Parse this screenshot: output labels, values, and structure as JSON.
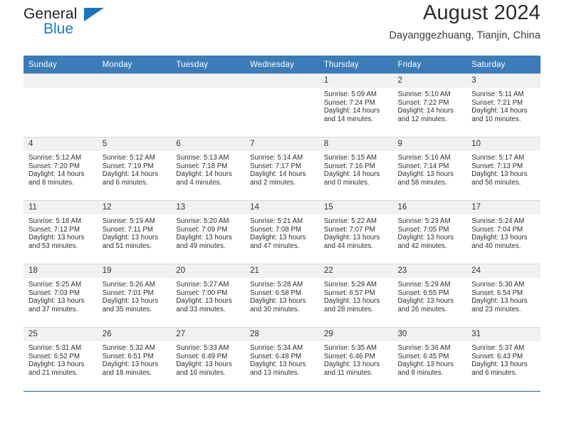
{
  "brand": {
    "name_top": "General",
    "name_bottom": "Blue",
    "triangle_color": "#1b75bb"
  },
  "header": {
    "title": "August 2024",
    "location": "Dayanggezhuang, Tianjin, China"
  },
  "theme": {
    "header_bg": "#3b7cb9",
    "header_text": "#ffffff",
    "daynum_bg": "#f1f1f1",
    "grid_line": "#d2d7dc"
  },
  "weekday_headers": [
    "Sunday",
    "Monday",
    "Tuesday",
    "Wednesday",
    "Thursday",
    "Friday",
    "Saturday"
  ],
  "weeks": [
    [
      {
        "day": "",
        "empty": true,
        "sunrise": "",
        "sunset": "",
        "daylight1": "",
        "daylight2": ""
      },
      {
        "day": "",
        "empty": true,
        "sunrise": "",
        "sunset": "",
        "daylight1": "",
        "daylight2": ""
      },
      {
        "day": "",
        "empty": true,
        "sunrise": "",
        "sunset": "",
        "daylight1": "",
        "daylight2": ""
      },
      {
        "day": "",
        "empty": true,
        "sunrise": "",
        "sunset": "",
        "daylight1": "",
        "daylight2": ""
      },
      {
        "day": "1",
        "empty": false,
        "sunrise": "Sunrise: 5:09 AM",
        "sunset": "Sunset: 7:24 PM",
        "daylight1": "Daylight: 14 hours",
        "daylight2": "and 14 minutes."
      },
      {
        "day": "2",
        "empty": false,
        "sunrise": "Sunrise: 5:10 AM",
        "sunset": "Sunset: 7:22 PM",
        "daylight1": "Daylight: 14 hours",
        "daylight2": "and 12 minutes."
      },
      {
        "day": "3",
        "empty": false,
        "sunrise": "Sunrise: 5:11 AM",
        "sunset": "Sunset: 7:21 PM",
        "daylight1": "Daylight: 14 hours",
        "daylight2": "and 10 minutes."
      }
    ],
    [
      {
        "day": "4",
        "empty": false,
        "sunrise": "Sunrise: 5:12 AM",
        "sunset": "Sunset: 7:20 PM",
        "daylight1": "Daylight: 14 hours",
        "daylight2": "and 8 minutes."
      },
      {
        "day": "5",
        "empty": false,
        "sunrise": "Sunrise: 5:12 AM",
        "sunset": "Sunset: 7:19 PM",
        "daylight1": "Daylight: 14 hours",
        "daylight2": "and 6 minutes."
      },
      {
        "day": "6",
        "empty": false,
        "sunrise": "Sunrise: 5:13 AM",
        "sunset": "Sunset: 7:18 PM",
        "daylight1": "Daylight: 14 hours",
        "daylight2": "and 4 minutes."
      },
      {
        "day": "7",
        "empty": false,
        "sunrise": "Sunrise: 5:14 AM",
        "sunset": "Sunset: 7:17 PM",
        "daylight1": "Daylight: 14 hours",
        "daylight2": "and 2 minutes."
      },
      {
        "day": "8",
        "empty": false,
        "sunrise": "Sunrise: 5:15 AM",
        "sunset": "Sunset: 7:16 PM",
        "daylight1": "Daylight: 14 hours",
        "daylight2": "and 0 minutes."
      },
      {
        "day": "9",
        "empty": false,
        "sunrise": "Sunrise: 5:16 AM",
        "sunset": "Sunset: 7:14 PM",
        "daylight1": "Daylight: 13 hours",
        "daylight2": "and 58 minutes."
      },
      {
        "day": "10",
        "empty": false,
        "sunrise": "Sunrise: 5:17 AM",
        "sunset": "Sunset: 7:13 PM",
        "daylight1": "Daylight: 13 hours",
        "daylight2": "and 56 minutes."
      }
    ],
    [
      {
        "day": "11",
        "empty": false,
        "sunrise": "Sunrise: 5:18 AM",
        "sunset": "Sunset: 7:12 PM",
        "daylight1": "Daylight: 13 hours",
        "daylight2": "and 53 minutes."
      },
      {
        "day": "12",
        "empty": false,
        "sunrise": "Sunrise: 5:19 AM",
        "sunset": "Sunset: 7:11 PM",
        "daylight1": "Daylight: 13 hours",
        "daylight2": "and 51 minutes."
      },
      {
        "day": "13",
        "empty": false,
        "sunrise": "Sunrise: 5:20 AM",
        "sunset": "Sunset: 7:09 PM",
        "daylight1": "Daylight: 13 hours",
        "daylight2": "and 49 minutes."
      },
      {
        "day": "14",
        "empty": false,
        "sunrise": "Sunrise: 5:21 AM",
        "sunset": "Sunset: 7:08 PM",
        "daylight1": "Daylight: 13 hours",
        "daylight2": "and 47 minutes."
      },
      {
        "day": "15",
        "empty": false,
        "sunrise": "Sunrise: 5:22 AM",
        "sunset": "Sunset: 7:07 PM",
        "daylight1": "Daylight: 13 hours",
        "daylight2": "and 44 minutes."
      },
      {
        "day": "16",
        "empty": false,
        "sunrise": "Sunrise: 5:23 AM",
        "sunset": "Sunset: 7:05 PM",
        "daylight1": "Daylight: 13 hours",
        "daylight2": "and 42 minutes."
      },
      {
        "day": "17",
        "empty": false,
        "sunrise": "Sunrise: 5:24 AM",
        "sunset": "Sunset: 7:04 PM",
        "daylight1": "Daylight: 13 hours",
        "daylight2": "and 40 minutes."
      }
    ],
    [
      {
        "day": "18",
        "empty": false,
        "sunrise": "Sunrise: 5:25 AM",
        "sunset": "Sunset: 7:03 PM",
        "daylight1": "Daylight: 13 hours",
        "daylight2": "and 37 minutes."
      },
      {
        "day": "19",
        "empty": false,
        "sunrise": "Sunrise: 5:26 AM",
        "sunset": "Sunset: 7:01 PM",
        "daylight1": "Daylight: 13 hours",
        "daylight2": "and 35 minutes."
      },
      {
        "day": "20",
        "empty": false,
        "sunrise": "Sunrise: 5:27 AM",
        "sunset": "Sunset: 7:00 PM",
        "daylight1": "Daylight: 13 hours",
        "daylight2": "and 33 minutes."
      },
      {
        "day": "21",
        "empty": false,
        "sunrise": "Sunrise: 5:28 AM",
        "sunset": "Sunset: 6:58 PM",
        "daylight1": "Daylight: 13 hours",
        "daylight2": "and 30 minutes."
      },
      {
        "day": "22",
        "empty": false,
        "sunrise": "Sunrise: 5:29 AM",
        "sunset": "Sunset: 6:57 PM",
        "daylight1": "Daylight: 13 hours",
        "daylight2": "and 28 minutes."
      },
      {
        "day": "23",
        "empty": false,
        "sunrise": "Sunrise: 5:29 AM",
        "sunset": "Sunset: 6:55 PM",
        "daylight1": "Daylight: 13 hours",
        "daylight2": "and 26 minutes."
      },
      {
        "day": "24",
        "empty": false,
        "sunrise": "Sunrise: 5:30 AM",
        "sunset": "Sunset: 6:54 PM",
        "daylight1": "Daylight: 13 hours",
        "daylight2": "and 23 minutes."
      }
    ],
    [
      {
        "day": "25",
        "empty": false,
        "sunrise": "Sunrise: 5:31 AM",
        "sunset": "Sunset: 6:52 PM",
        "daylight1": "Daylight: 13 hours",
        "daylight2": "and 21 minutes."
      },
      {
        "day": "26",
        "empty": false,
        "sunrise": "Sunrise: 5:32 AM",
        "sunset": "Sunset: 6:51 PM",
        "daylight1": "Daylight: 13 hours",
        "daylight2": "and 18 minutes."
      },
      {
        "day": "27",
        "empty": false,
        "sunrise": "Sunrise: 5:33 AM",
        "sunset": "Sunset: 6:49 PM",
        "daylight1": "Daylight: 13 hours",
        "daylight2": "and 16 minutes."
      },
      {
        "day": "28",
        "empty": false,
        "sunrise": "Sunrise: 5:34 AM",
        "sunset": "Sunset: 6:48 PM",
        "daylight1": "Daylight: 13 hours",
        "daylight2": "and 13 minutes."
      },
      {
        "day": "29",
        "empty": false,
        "sunrise": "Sunrise: 5:35 AM",
        "sunset": "Sunset: 6:46 PM",
        "daylight1": "Daylight: 13 hours",
        "daylight2": "and 11 minutes."
      },
      {
        "day": "30",
        "empty": false,
        "sunrise": "Sunrise: 5:36 AM",
        "sunset": "Sunset: 6:45 PM",
        "daylight1": "Daylight: 13 hours",
        "daylight2": "and 8 minutes."
      },
      {
        "day": "31",
        "empty": false,
        "sunrise": "Sunrise: 5:37 AM",
        "sunset": "Sunset: 6:43 PM",
        "daylight1": "Daylight: 13 hours",
        "daylight2": "and 6 minutes."
      }
    ]
  ]
}
